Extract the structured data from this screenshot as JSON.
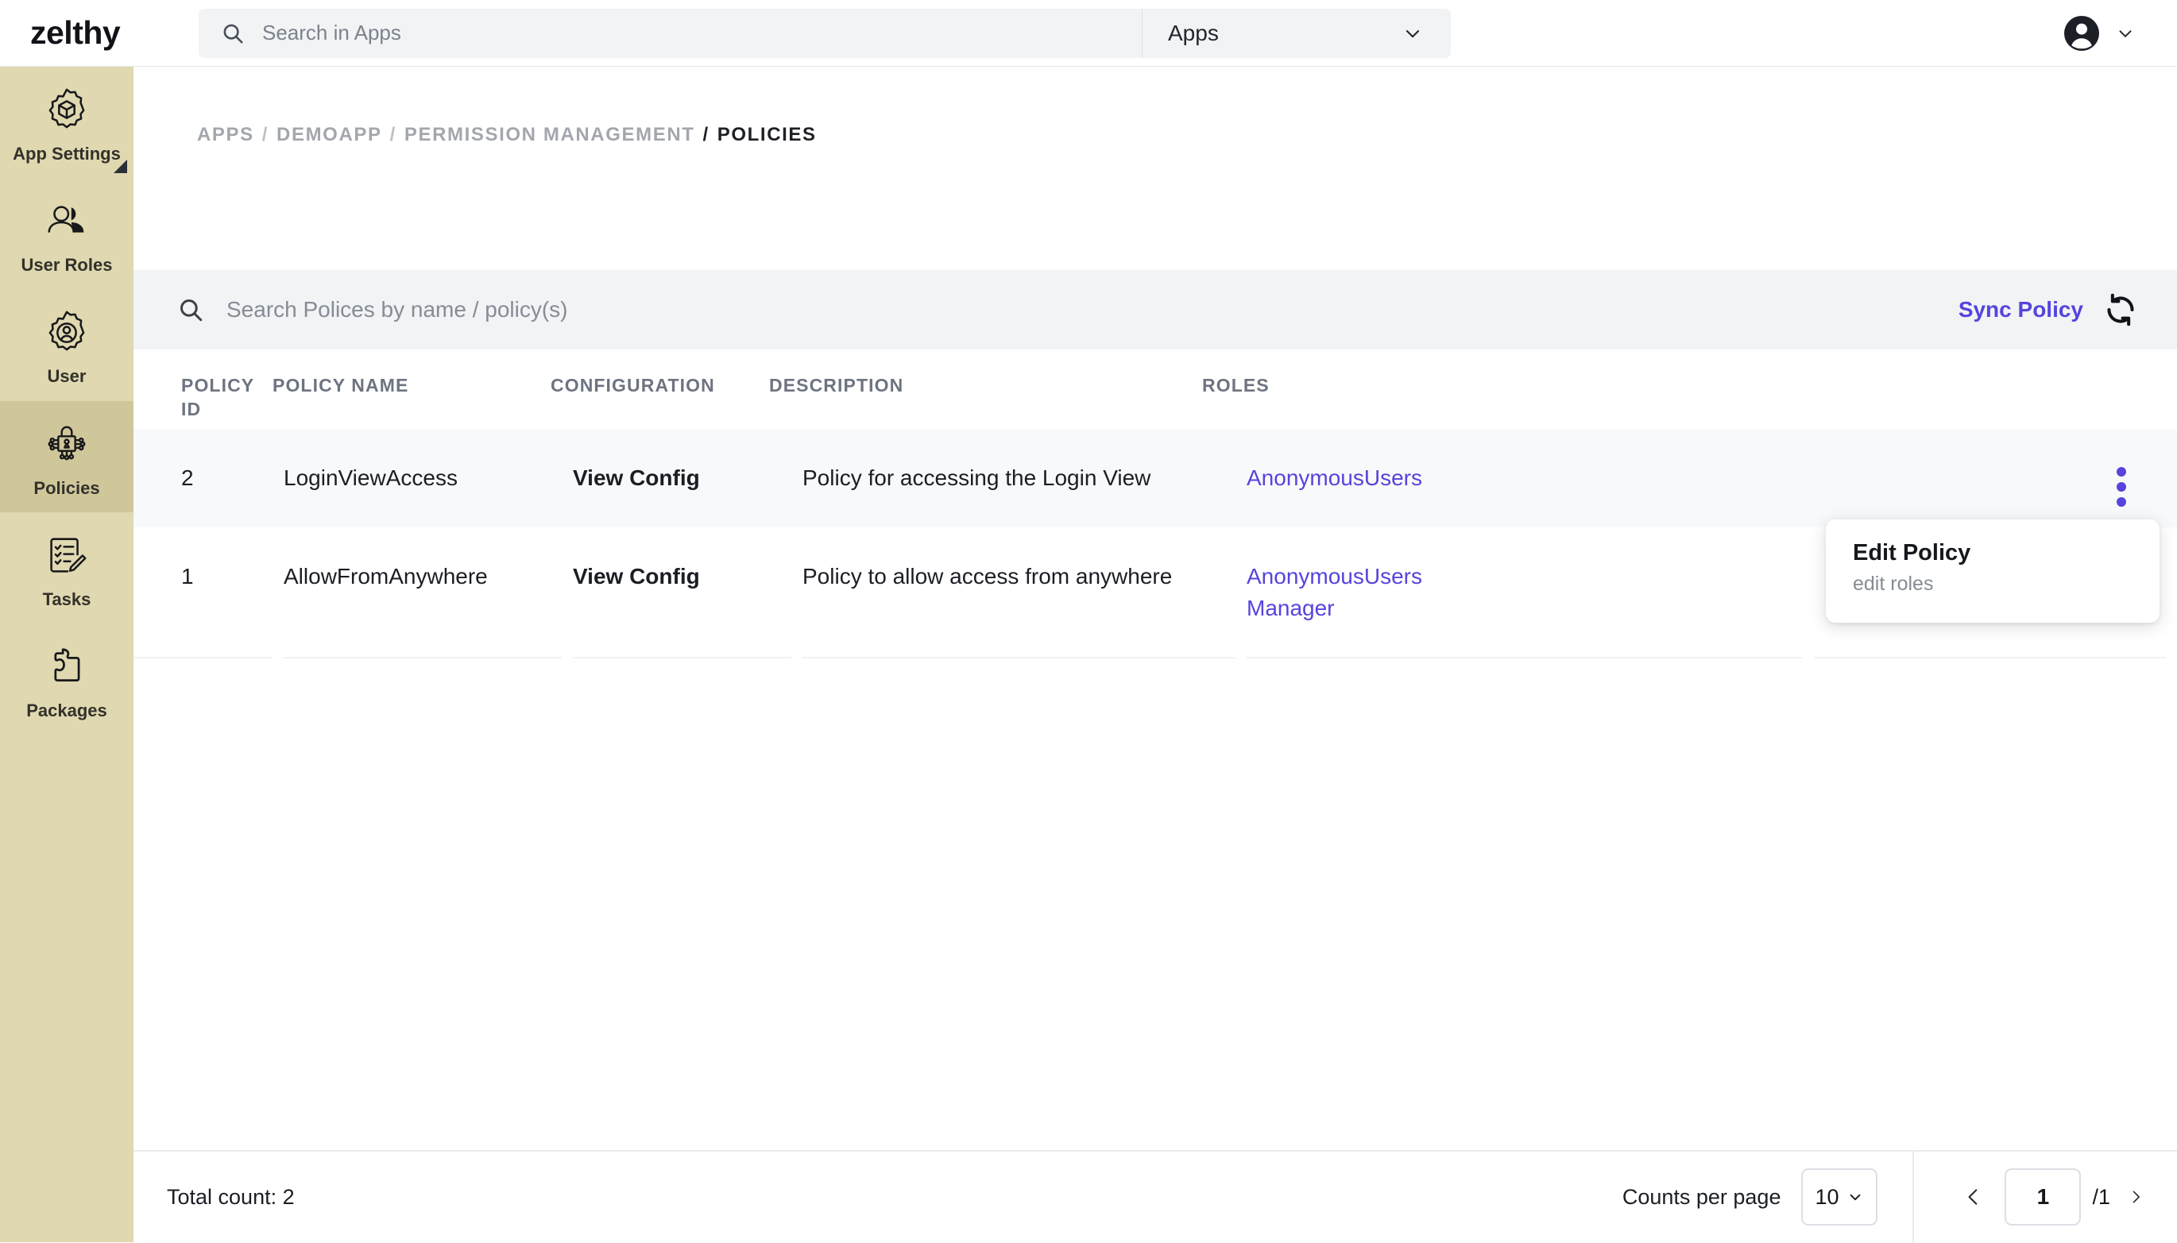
{
  "app": {
    "brand": "zelthy"
  },
  "topbar": {
    "search_placeholder": "Search in Apps",
    "search_value": "",
    "app_selector_label": "Apps",
    "search_icon": "search-icon",
    "chevron_icon": "chevron-down-icon",
    "avatar_icon": "account-circle-icon"
  },
  "sidebar": {
    "items": [
      {
        "label": "App Settings",
        "icon": "gear-cube-icon",
        "active": false,
        "marker": true
      },
      {
        "label": "User Roles",
        "icon": "users-icon",
        "active": false,
        "marker": false
      },
      {
        "label": "User",
        "icon": "gear-user-icon",
        "active": false,
        "marker": false
      },
      {
        "label": "Policies",
        "icon": "lock-circuit-icon",
        "active": true,
        "marker": false
      },
      {
        "label": "Tasks",
        "icon": "checklist-pencil-icon",
        "active": false,
        "marker": false
      },
      {
        "label": "Packages",
        "icon": "puzzle-piece-icon",
        "active": false,
        "marker": false
      }
    ]
  },
  "breadcrumb": {
    "items": [
      "APPS",
      "DEMOAPP",
      "PERMISSION MANAGEMENT",
      "POLICIES"
    ],
    "separator": "/",
    "current_index": 3
  },
  "toolbar": {
    "search_placeholder": "Search Polices by name / policy(s)",
    "search_value": "",
    "search_icon": "search-icon",
    "sync_label": "Sync Policy",
    "sync_icon": "refresh-icon"
  },
  "table": {
    "columns": [
      {
        "label": "POLICY ID"
      },
      {
        "label": "POLICY NAME"
      },
      {
        "label": "CONFIGURATION"
      },
      {
        "label": "DESCRIPTION"
      },
      {
        "label": "ROLES"
      },
      {
        "label": ""
      }
    ],
    "rows": [
      {
        "policy_id": "2",
        "policy_name": "LoginViewAccess",
        "configuration": "View Config",
        "description": "Policy for accessing the Login View",
        "roles": [
          "AnonymousUsers"
        ],
        "menu_icon": "kebab-menu-icon"
      },
      {
        "policy_id": "1",
        "policy_name": "AllowFromAnywhere",
        "configuration": "View Config",
        "description": "Policy to allow access from anywhere",
        "roles": [
          "AnonymousUsers",
          "Manager"
        ],
        "menu_icon": "kebab-menu-icon"
      }
    ]
  },
  "dropdown": {
    "title": "Edit Policy",
    "subtitle": "edit roles"
  },
  "footer": {
    "total_count": "Total count: 2",
    "counts_per_page_label": "Counts per page",
    "counts_per_page_value": "10",
    "prev_icon": "chevron-left-icon",
    "next_icon": "chevron-right-icon",
    "current_page": "1",
    "page_of": "/1"
  },
  "colors": {
    "accent": "#5544dd",
    "sidebar": "#dfd8b0",
    "sidebar_active": "#cfc69a",
    "strip": "#f1f3f5",
    "row_shaded": "#f8f9fa"
  }
}
